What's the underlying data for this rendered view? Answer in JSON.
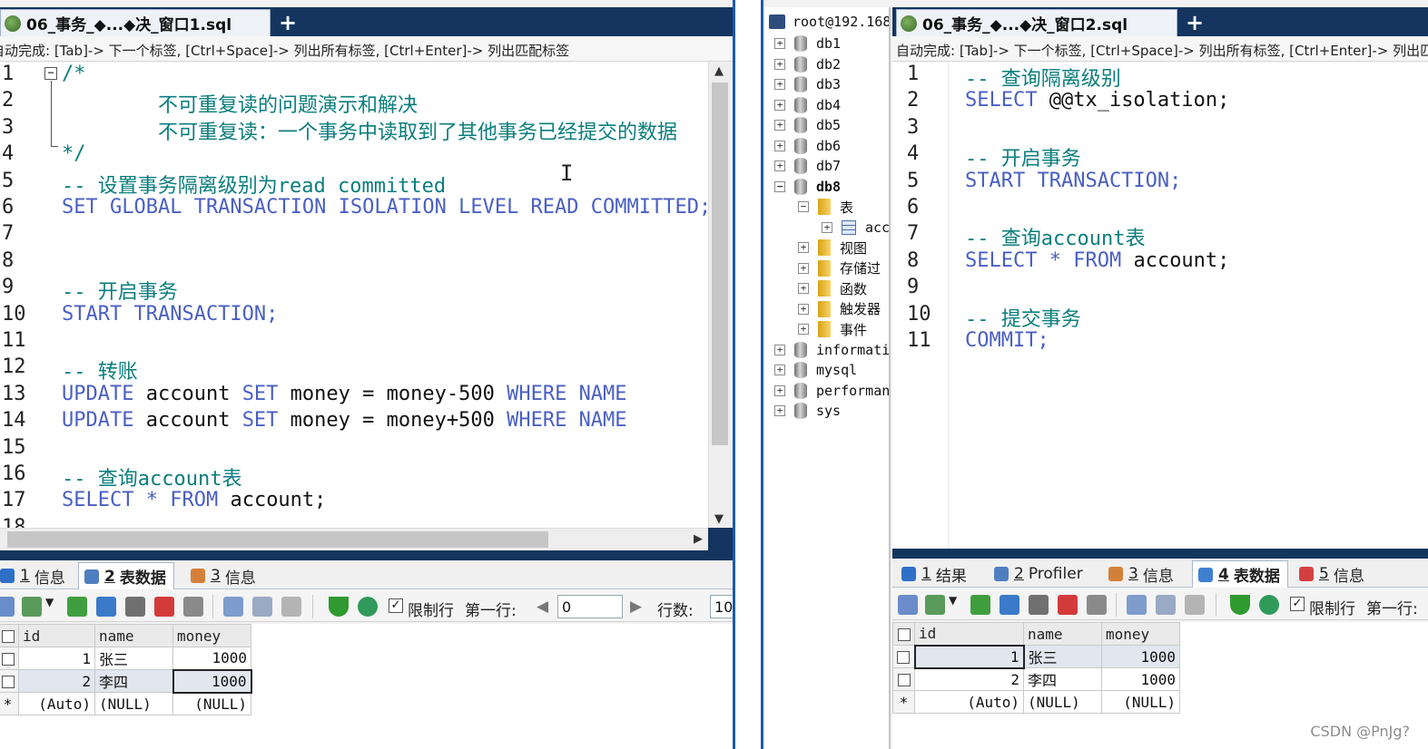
{
  "left_window": {
    "tab_title": "06_事务_◆...◆决_窗口1.sql",
    "plus_label": "+",
    "autocomplete_hint": "自动完成:  [Tab]-> 下一个标签, [Ctrl+Space]-> 列出所有标签, [Ctrl+Enter]-> 列出匹配标签",
    "line_numbers": [
      "1",
      "2",
      "3",
      "4",
      "5",
      "6",
      "7",
      "8",
      "9",
      "10",
      "11",
      "12",
      "13",
      "14",
      "15",
      "16",
      "17",
      "18"
    ],
    "code_lines": [
      {
        "n": 1,
        "type": "com",
        "text": "/*"
      },
      {
        "n": 2,
        "type": "com",
        "text": "        不可重复读的问题演示和解决"
      },
      {
        "n": 3,
        "type": "com",
        "text": "        不可重复读：一个事务中读取到了其他事务已经提交的数据"
      },
      {
        "n": 4,
        "type": "com",
        "text": "*/"
      },
      {
        "n": 5,
        "type": "com",
        "text": "-- 设置事务隔离级别为read committed"
      },
      {
        "n": 6,
        "type": "kw",
        "text": "SET GLOBAL TRANSACTION ISOLATION LEVEL READ COMMITTED;"
      },
      {
        "n": 7,
        "type": "plain",
        "text": ""
      },
      {
        "n": 8,
        "type": "plain",
        "text": ""
      },
      {
        "n": 9,
        "type": "com",
        "text": "-- 开启事务"
      },
      {
        "n": 10,
        "type": "kw",
        "text": "START TRANSACTION;"
      },
      {
        "n": 11,
        "type": "plain",
        "text": ""
      },
      {
        "n": 12,
        "type": "com",
        "text": "-- 转账"
      },
      {
        "n": 13,
        "type": "mixed",
        "parts": [
          [
            "kw",
            "UPDATE "
          ],
          [
            "plain",
            "account "
          ],
          [
            "kw",
            "SET "
          ],
          [
            "plain",
            "money = money-500 "
          ],
          [
            "kw",
            "WHERE NAME"
          ]
        ]
      },
      {
        "n": 14,
        "type": "mixed",
        "parts": [
          [
            "kw",
            "UPDATE "
          ],
          [
            "plain",
            "account "
          ],
          [
            "kw",
            "SET "
          ],
          [
            "plain",
            "money = money+500 "
          ],
          [
            "kw",
            "WHERE NAME"
          ]
        ]
      },
      {
        "n": 15,
        "type": "plain",
        "text": ""
      },
      {
        "n": 16,
        "type": "com",
        "text": "-- 查询account表"
      },
      {
        "n": 17,
        "type": "mixed",
        "parts": [
          [
            "kw",
            "SELECT "
          ],
          [
            "kw",
            "* "
          ],
          [
            "kw",
            "FROM "
          ],
          [
            "plain",
            "account;"
          ]
        ]
      },
      {
        "n": 18,
        "type": "plain",
        "text": ""
      }
    ],
    "result_tabs": [
      {
        "num": "1",
        "label": "信息",
        "active": false
      },
      {
        "num": "2",
        "label": "表数据",
        "active": true
      },
      {
        "num": "3",
        "label": "信息",
        "active": false
      }
    ],
    "toolbar": {
      "limit_label": "限制行",
      "first_row_label": "第一行:",
      "first_row_value": "0",
      "rows_label": "行数:",
      "rows_value": "10"
    },
    "grid": {
      "columns": [
        "id",
        "name",
        "money"
      ],
      "rows": [
        [
          "1",
          "张三",
          "1000"
        ],
        [
          "2",
          "李四",
          "1000"
        ],
        [
          "(Auto)",
          "(NULL)",
          "(NULL)"
        ]
      ]
    }
  },
  "right_window": {
    "tree": {
      "server": "root@192.168",
      "nodes": [
        {
          "label": "db1",
          "kind": "db",
          "level": 0,
          "toggle": "+"
        },
        {
          "label": "db2",
          "kind": "db",
          "level": 0,
          "toggle": "+"
        },
        {
          "label": "db3",
          "kind": "db",
          "level": 0,
          "toggle": "+"
        },
        {
          "label": "db4",
          "kind": "db",
          "level": 0,
          "toggle": "+"
        },
        {
          "label": "db5",
          "kind": "db",
          "level": 0,
          "toggle": "+"
        },
        {
          "label": "db6",
          "kind": "db",
          "level": 0,
          "toggle": "+"
        },
        {
          "label": "db7",
          "kind": "db",
          "level": 0,
          "toggle": "+"
        },
        {
          "label": "db8",
          "kind": "db",
          "level": 0,
          "toggle": "−",
          "bold": true
        },
        {
          "label": "表",
          "kind": "folder",
          "level": 1,
          "toggle": "−"
        },
        {
          "label": "acc",
          "kind": "table",
          "level": 2,
          "toggle": "+"
        },
        {
          "label": "视图",
          "kind": "folder",
          "level": 1,
          "toggle": "+"
        },
        {
          "label": "存储过",
          "kind": "folder",
          "level": 1,
          "toggle": "+"
        },
        {
          "label": "函数",
          "kind": "folder",
          "level": 1,
          "toggle": "+"
        },
        {
          "label": "触发器",
          "kind": "folder",
          "level": 1,
          "toggle": "+"
        },
        {
          "label": "事件",
          "kind": "folder",
          "level": 1,
          "toggle": "+"
        },
        {
          "label": "informati",
          "kind": "db",
          "level": 0,
          "toggle": "+"
        },
        {
          "label": "mysql",
          "kind": "db",
          "level": 0,
          "toggle": "+"
        },
        {
          "label": "performan",
          "kind": "db",
          "level": 0,
          "toggle": "+"
        },
        {
          "label": "sys",
          "kind": "db",
          "level": 0,
          "toggle": "+"
        }
      ]
    },
    "tab_title": "06_事务_◆...◆决_窗口2.sql",
    "plus_label": "+",
    "autocomplete_hint": "自动完成:  [Tab]-> 下一个标签, [Ctrl+Space]-> 列出所有标签, [Ctrl+Enter]-> 列出匹配标签",
    "line_numbers": [
      "1",
      "2",
      "3",
      "4",
      "5",
      "6",
      "7",
      "8",
      "9",
      "10",
      "11"
    ],
    "code_lines": [
      {
        "n": 1,
        "type": "com",
        "text": "-- 查询隔离级别"
      },
      {
        "n": 2,
        "type": "mixed",
        "parts": [
          [
            "kw",
            "SELECT "
          ],
          [
            "plain",
            "@@tx_isolation;"
          ]
        ]
      },
      {
        "n": 3,
        "type": "plain",
        "text": ""
      },
      {
        "n": 4,
        "type": "com",
        "text": "-- 开启事务"
      },
      {
        "n": 5,
        "type": "kw",
        "text": "START TRANSACTION;"
      },
      {
        "n": 6,
        "type": "plain",
        "text": ""
      },
      {
        "n": 7,
        "type": "com",
        "text": "-- 查询account表"
      },
      {
        "n": 8,
        "type": "mixed",
        "parts": [
          [
            "kw",
            "SELECT "
          ],
          [
            "kw",
            "* "
          ],
          [
            "kw",
            "FROM "
          ],
          [
            "plain",
            "account;"
          ]
        ]
      },
      {
        "n": 9,
        "type": "plain",
        "text": ""
      },
      {
        "n": 10,
        "type": "com",
        "text": "-- 提交事务"
      },
      {
        "n": 11,
        "type": "kw",
        "text": "COMMIT;"
      }
    ],
    "result_tabs": [
      {
        "num": "1",
        "label": "结果",
        "active": false
      },
      {
        "num": "2",
        "label": "Profiler",
        "active": false
      },
      {
        "num": "3",
        "label": "信息",
        "active": false
      },
      {
        "num": "4",
        "label": "表数据",
        "active": true
      },
      {
        "num": "5",
        "label": "信息",
        "active": false
      }
    ],
    "toolbar": {
      "limit_label": "限制行",
      "first_row_label": "第一行:"
    },
    "grid": {
      "columns": [
        "id",
        "name",
        "money"
      ],
      "rows": [
        [
          "1",
          "张三",
          "1000"
        ],
        [
          "2",
          "李四",
          "1000"
        ],
        [
          "(Auto)",
          "(NULL)",
          "(NULL)"
        ]
      ]
    }
  },
  "watermark": "CSDN @PnJg?",
  "colors": {
    "comment": "#0b7d7d",
    "keyword": "#4a5fc4",
    "tab_bar": "#14355f"
  }
}
